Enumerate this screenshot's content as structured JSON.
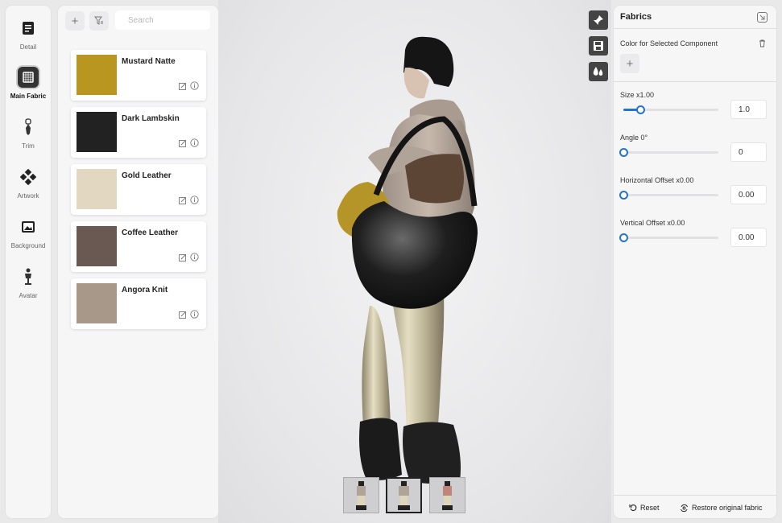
{
  "rail": {
    "items": [
      {
        "label": "Detail",
        "icon": "detail-icon"
      },
      {
        "label": "Main Fabric",
        "icon": "main-fabric-icon",
        "active": true
      },
      {
        "label": "Trim",
        "icon": "zipper-icon"
      },
      {
        "label": "Artwork",
        "icon": "artwork-icon"
      },
      {
        "label": "Background",
        "icon": "background-icon"
      },
      {
        "label": "Avatar",
        "icon": "avatar-icon"
      }
    ]
  },
  "list": {
    "search_placeholder": "Search",
    "fabrics": [
      {
        "name": "Mustard Natte",
        "color": "#b9961f"
      },
      {
        "name": "Dark Lambskin",
        "color": "#232222"
      },
      {
        "name": "Gold Leather",
        "color": "#e2d8c1"
      },
      {
        "name": "Coffee Leather",
        "color": "#6a5952"
      },
      {
        "name": "Angora Knit",
        "color": "#a8988a"
      }
    ]
  },
  "properties": {
    "title": "Fabrics",
    "color_section_label": "Color for Selected Component",
    "sliders": [
      {
        "label": "Size x1.00",
        "value": "1.0",
        "fraction": 0.18
      },
      {
        "label": "Angle 0°",
        "value": "0",
        "fraction": 0
      },
      {
        "label": "Horizontal Offset x0.00",
        "value": "0.00",
        "fraction": 0
      },
      {
        "label": "Vertical Offset x0.00",
        "value": "0.00",
        "fraction": 0
      }
    ],
    "reset_label": "Reset",
    "restore_label": "Restore original fabric"
  },
  "colors": {
    "accent": "#2475c9"
  }
}
